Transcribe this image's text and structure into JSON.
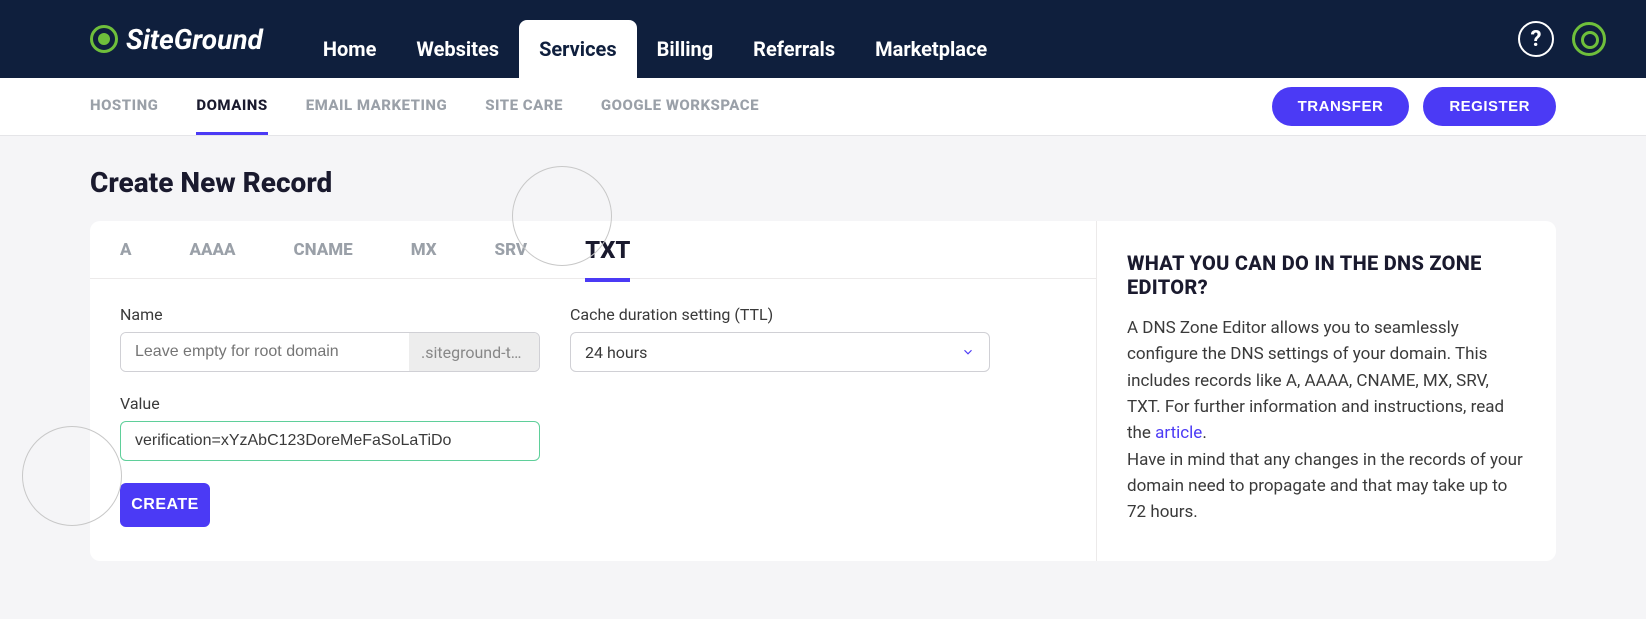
{
  "brand": "SiteGround",
  "topnav": {
    "items": [
      {
        "label": "Home"
      },
      {
        "label": "Websites"
      },
      {
        "label": "Services",
        "active": true
      },
      {
        "label": "Billing"
      },
      {
        "label": "Referrals"
      },
      {
        "label": "Marketplace"
      }
    ]
  },
  "subnav": {
    "items": [
      {
        "label": "HOSTING"
      },
      {
        "label": "DOMAINS",
        "active": true
      },
      {
        "label": "EMAIL MARKETING"
      },
      {
        "label": "SITE CARE"
      },
      {
        "label": "GOOGLE WORKSPACE"
      }
    ],
    "transfer": "TRANSFER",
    "register": "REGISTER"
  },
  "page": {
    "title": "Create New Record",
    "record_tabs": [
      {
        "label": "A"
      },
      {
        "label": "AAAA"
      },
      {
        "label": "CNAME"
      },
      {
        "label": "MX"
      },
      {
        "label": "SRV"
      },
      {
        "label": "TXT",
        "active": true
      }
    ],
    "name_label": "Name",
    "name_placeholder": "Leave empty for root domain",
    "name_suffix": ".siteground-t…",
    "ttl_label": "Cache duration setting (TTL)",
    "ttl_value": "24 hours",
    "value_label": "Value",
    "value_input": "verification=xYzAbC123DoreMeFaSoLaTiDo",
    "create_label": "CREATE"
  },
  "help": {
    "title": "WHAT YOU CAN DO IN THE DNS ZONE EDITOR?",
    "p1a": "A DNS Zone Editor allows you to seamlessly configure the DNS settings of your domain. This includes records like A, AAAA, CNAME, MX, SRV, TXT. For further information and instructions, read the ",
    "link": "article",
    "p1b": ".",
    "p2": "Have in mind that any changes in the records of your domain need to propagate and that may take up to 72 hours."
  }
}
